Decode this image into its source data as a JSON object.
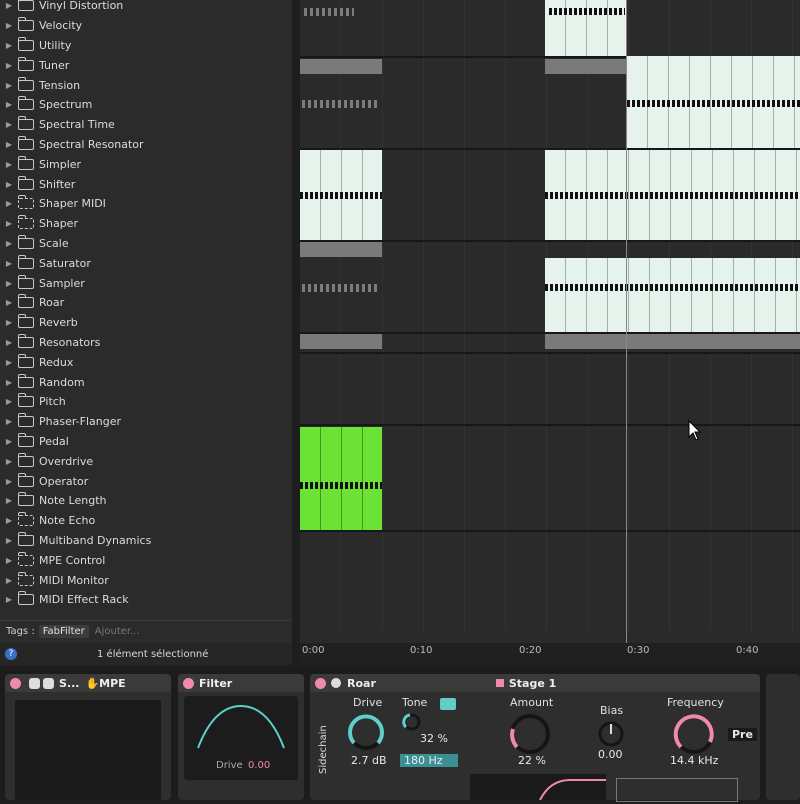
{
  "browser": {
    "items": [
      {
        "label": "Vinyl Distortion",
        "midi": false
      },
      {
        "label": "Velocity",
        "midi": false
      },
      {
        "label": "Utility",
        "midi": false
      },
      {
        "label": "Tuner",
        "midi": false
      },
      {
        "label": "Tension",
        "midi": false
      },
      {
        "label": "Spectrum",
        "midi": false
      },
      {
        "label": "Spectral Time",
        "midi": false
      },
      {
        "label": "Spectral Resonator",
        "midi": false
      },
      {
        "label": "Simpler",
        "midi": false
      },
      {
        "label": "Shifter",
        "midi": false
      },
      {
        "label": "Shaper MIDI",
        "midi": true
      },
      {
        "label": "Shaper",
        "midi": true
      },
      {
        "label": "Scale",
        "midi": false
      },
      {
        "label": "Saturator",
        "midi": false
      },
      {
        "label": "Sampler",
        "midi": false
      },
      {
        "label": "Roar",
        "midi": false
      },
      {
        "label": "Reverb",
        "midi": false
      },
      {
        "label": "Resonators",
        "midi": false
      },
      {
        "label": "Redux",
        "midi": false
      },
      {
        "label": "Random",
        "midi": false
      },
      {
        "label": "Pitch",
        "midi": false
      },
      {
        "label": "Phaser-Flanger",
        "midi": false
      },
      {
        "label": "Pedal",
        "midi": false
      },
      {
        "label": "Overdrive",
        "midi": false
      },
      {
        "label": "Operator",
        "midi": false
      },
      {
        "label": "Note Length",
        "midi": false
      },
      {
        "label": "Note Echo",
        "midi": true
      },
      {
        "label": "Multiband Dynamics",
        "midi": false
      },
      {
        "label": "MPE Control",
        "midi": true
      },
      {
        "label": "MIDI Monitor",
        "midi": true
      },
      {
        "label": "MIDI Effect Rack",
        "midi": false
      }
    ],
    "tags_label": "Tags :",
    "tag_chip": "FabFilter",
    "tag_add": "Ajouter...",
    "status": "1 élément sélectionné"
  },
  "ruler": [
    "0:00",
    "0:10",
    "0:20",
    "0:30",
    "0:40"
  ],
  "devices": {
    "mpe_title": "S...",
    "mpe_tag": "MPE",
    "filter_title": "Filter",
    "filter_drive_label": "Drive",
    "filter_drive_value": "0.00",
    "roar_title": "Roar",
    "stage_label": "Stage 1",
    "sidechain": "Sidechain",
    "drive_label": "Drive",
    "drive_value": "2.7 dB",
    "tone_label": "Tone",
    "tone_value": "32 %",
    "tone_freq": "180 Hz",
    "amount_label": "Amount",
    "amount_value": "22 %",
    "bias_label": "Bias",
    "bias_value": "0.00",
    "freq_label": "Frequency",
    "freq_value": "14.4 kHz",
    "pre_label": "Pre"
  },
  "colors": {
    "clip_light": "#e6f3ec",
    "clip_green": "#6ce234",
    "knob_teal": "#5fcfc9",
    "knob_pink": "#f08aa8"
  }
}
